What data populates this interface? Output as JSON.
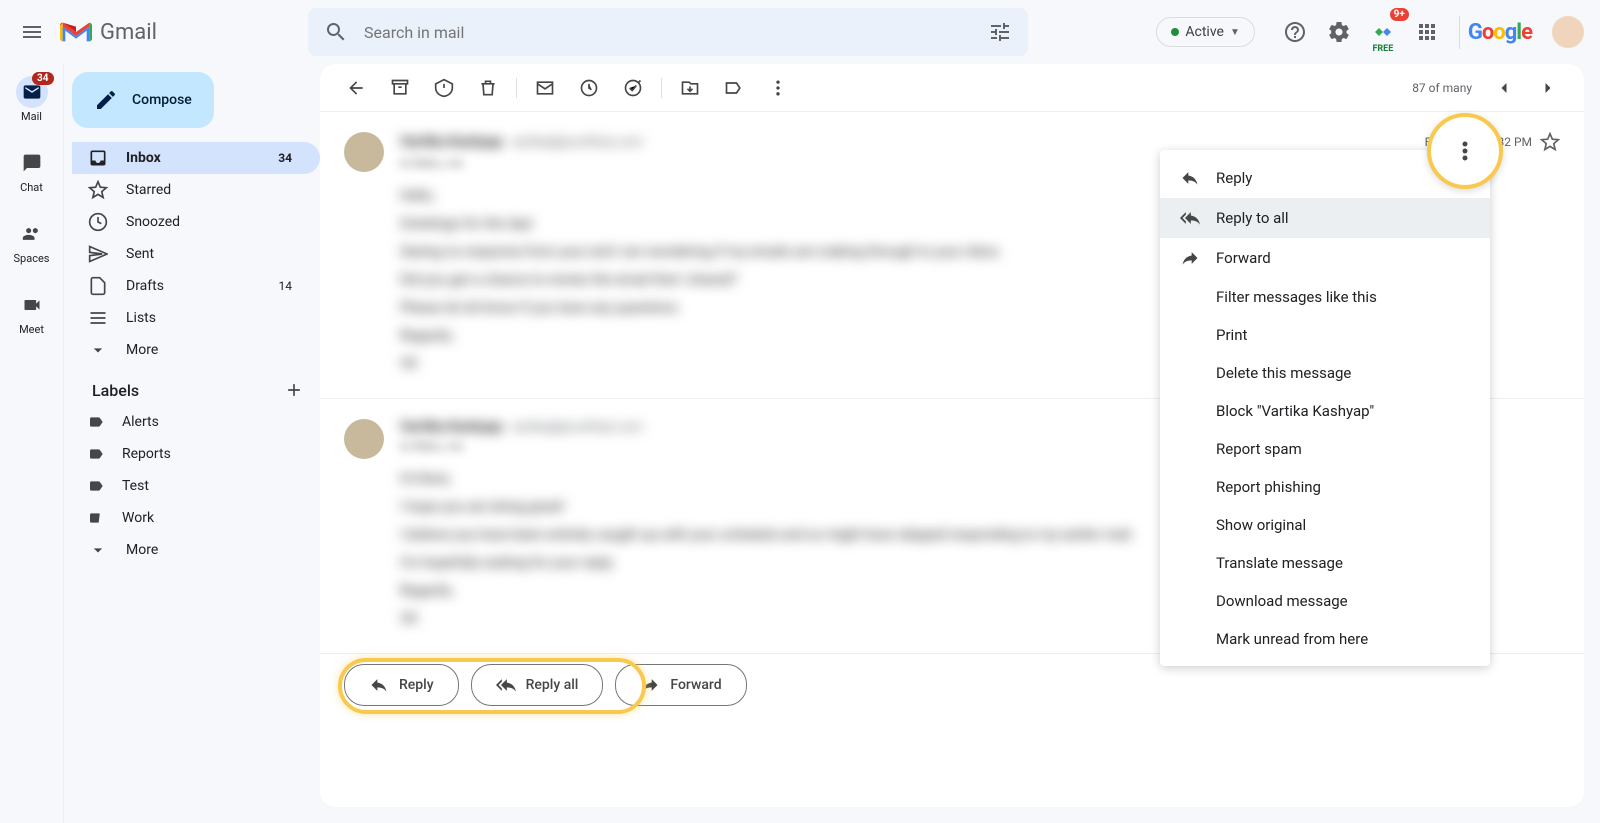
{
  "header": {
    "logo": "Gmail",
    "search_placeholder": "Search in mail",
    "status": "Active",
    "badge": "9+",
    "free": "FREE",
    "google": "Google"
  },
  "rail": {
    "mail": "Mail",
    "mail_badge": "34",
    "chat": "Chat",
    "spaces": "Spaces",
    "meet": "Meet"
  },
  "sidebar": {
    "compose": "Compose",
    "inbox": "Inbox",
    "inbox_count": "34",
    "starred": "Starred",
    "snoozed": "Snoozed",
    "sent": "Sent",
    "drafts": "Drafts",
    "drafts_count": "14",
    "lists": "Lists",
    "more": "More",
    "labels_header": "Labels",
    "labels": {
      "alerts": "Alerts",
      "reports": "Reports",
      "test": "Test",
      "work": "Work"
    },
    "more2": "More"
  },
  "toolbar": {
    "pager": "87 of many"
  },
  "msg1": {
    "sender": "Vartika Kashyap",
    "email": "vartika@proofhub.com",
    "date": "Fri, May 13, 4:32 PM",
    "to": "to Babu, me",
    "l1": "Hello,",
    "l2": "Greetings for the day!",
    "l3": "Seeing no response from your end I am wondering if my emails are making through to your inbox.",
    "l4": "Did you get a chance to review the email that I shared?",
    "l5": "Please do let know if you have any questions.",
    "l6": "Regards,",
    "l7": "VK"
  },
  "msg2": {
    "sender": "Vartika Kashyap",
    "email": "vartika@proofhub.com",
    "to": "to Babu, me",
    "l1": "Hi there,",
    "l2": "I hope you are doing great!",
    "l3": "I believe you have been entirely caught up with your schedule and so might have skipped responding to my earlier mail.",
    "l4": "I'm hopefully waiting for your reply.",
    "l5": "Regards,",
    "l6": "VK"
  },
  "actions": {
    "reply": "Reply",
    "reply_all": "Reply all",
    "forward": "Forward"
  },
  "ctx": {
    "reply": "Reply",
    "reply_all": "Reply to all",
    "forward": "Forward",
    "filter": "Filter messages like this",
    "print": "Print",
    "delete": "Delete this message",
    "block": "Block \"Vartika Kashyap\"",
    "spam": "Report spam",
    "phishing": "Report phishing",
    "original": "Show original",
    "translate": "Translate message",
    "download": "Download message",
    "unread": "Mark unread from here"
  }
}
